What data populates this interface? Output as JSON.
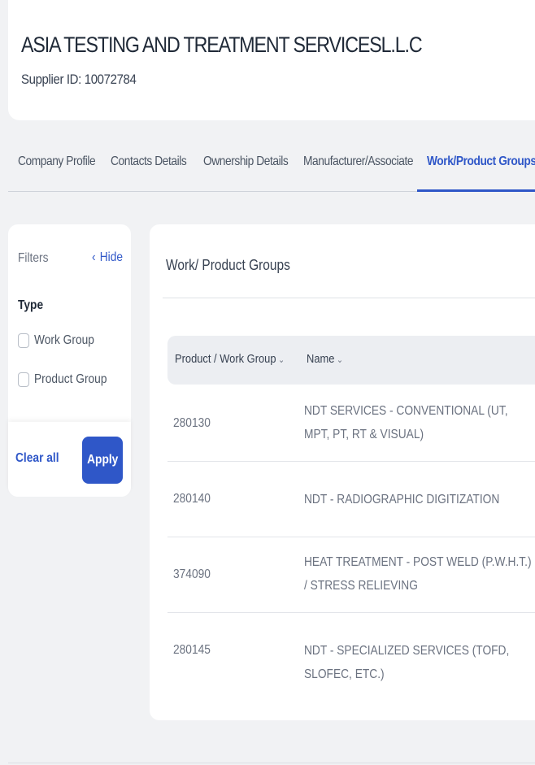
{
  "header": {
    "company_name": "ASIA TESTING AND TREATMENT SERVICESL.L.C",
    "supplier_id": "Supplier ID: 10072784"
  },
  "tabs": [
    {
      "label": "Company Profile"
    },
    {
      "label": "Contacts Details"
    },
    {
      "label": "Ownership Details"
    },
    {
      "label": "Manufacturer/Associate"
    },
    {
      "label": "Work/Product Groups"
    }
  ],
  "active_tab": "Work/Product Groups",
  "filters": {
    "title": "Filters",
    "hide_label": "Hide",
    "type_label": "Type",
    "options": [
      {
        "label": "Work Group",
        "checked": false
      },
      {
        "label": "Product Group",
        "checked": false
      }
    ],
    "clear_label": "Clear all",
    "apply_label": "Apply"
  },
  "main": {
    "title": "Work/ Product Groups",
    "columns": [
      "Product / Work Group",
      "Name"
    ],
    "rows": [
      {
        "code": "280130",
        "name": "NDT SERVICES - CONVENTIONAL (UT, MPT, PT, RT & VISUAL)"
      },
      {
        "code": "280140",
        "name": "NDT - RADIOGRAPHIC DIGITIZATION"
      },
      {
        "code": "374090",
        "name": "HEAT TREATMENT - POST WELD (P.W.H.T.) / STRESS RELIEVING"
      },
      {
        "code": "280145",
        "name": "NDT - SPECIALIZED SERVICES (TOFD, SLOFEC, ETC.)"
      }
    ]
  },
  "colors": {
    "accent": "#2f57c8",
    "background": "#f1f2f4",
    "card": "#ffffff"
  }
}
